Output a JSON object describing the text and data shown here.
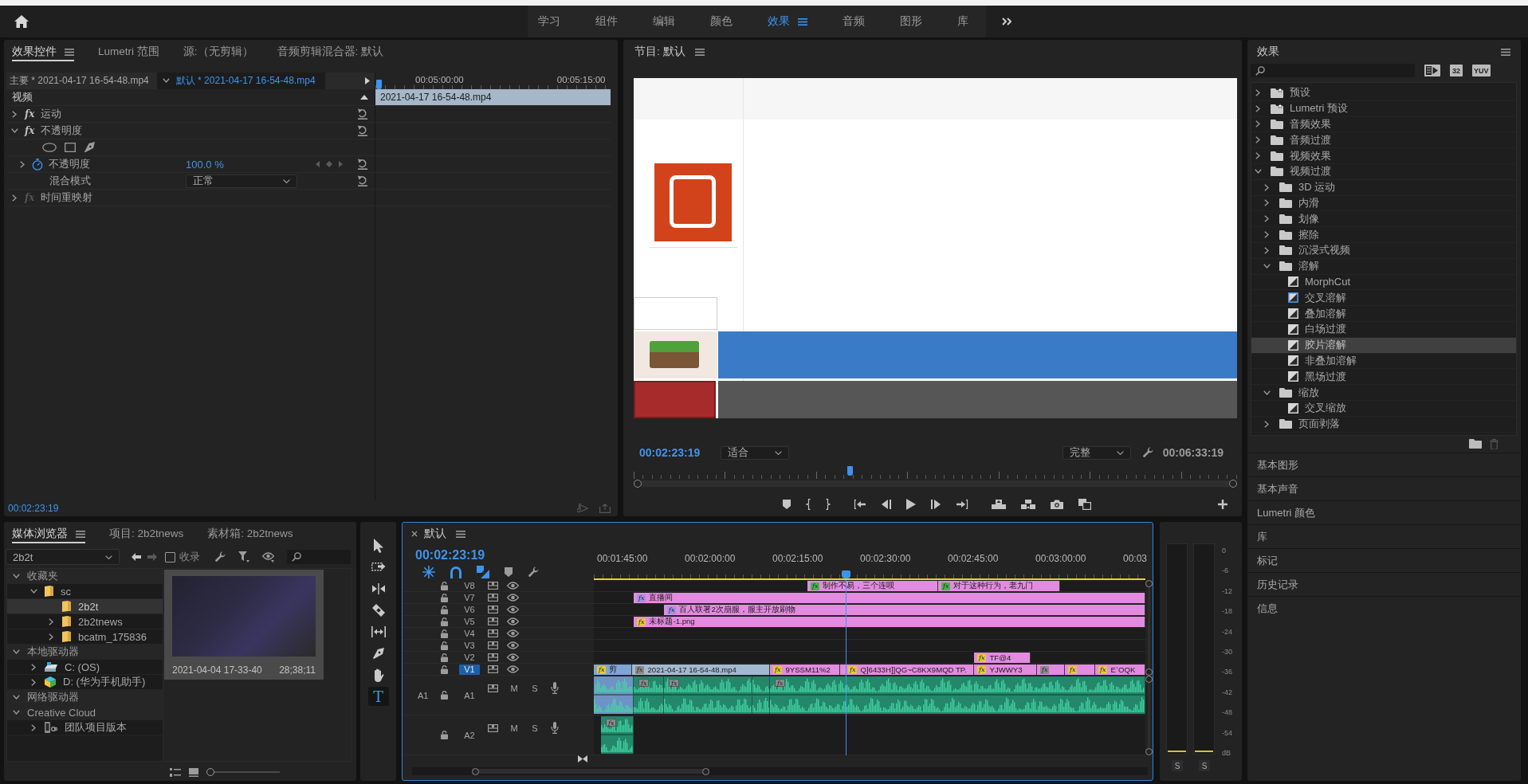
{
  "header": {
    "workspaces": [
      {
        "label": "学习",
        "selected": false
      },
      {
        "label": "组件",
        "selected": false
      },
      {
        "label": "编辑",
        "selected": false
      },
      {
        "label": "颜色",
        "selected": false
      },
      {
        "label": "效果",
        "selected": true
      },
      {
        "label": "音频",
        "selected": false
      },
      {
        "label": "图形",
        "selected": false
      },
      {
        "label": "库",
        "selected": false
      }
    ]
  },
  "effect_controls": {
    "tabs": [
      {
        "label": "效果控件",
        "selected": true
      },
      {
        "label": "Lumetri 范围",
        "selected": false
      },
      {
        "label": "源:（无剪辑）",
        "selected": false
      },
      {
        "label": "音频剪辑混合器: 默认",
        "selected": false
      }
    ],
    "master_clip": "主要 * 2021-04-17 16-54-48.mp4",
    "sequence_clip": "默认 * 2021-04-17 16-54-48.mp4",
    "ruler": [
      "00:05:00:00",
      "00:05:15:00"
    ],
    "section": "视频",
    "clip": "2021-04-17 16-54-48.mp4",
    "rows": [
      {
        "kind": "effect",
        "badge": "fx",
        "label": "运动",
        "expanded": false,
        "enabled": true
      },
      {
        "kind": "effect",
        "badge": "fx",
        "label": "不透明度",
        "expanded": true,
        "enabled": true
      },
      {
        "kind": "masks"
      },
      {
        "kind": "param",
        "label": "不透明度",
        "value": "100.0 %",
        "expanded": false
      },
      {
        "kind": "select",
        "label": "混合模式",
        "value": "正常"
      },
      {
        "kind": "effect",
        "badge": "fx",
        "label": "时间重映射",
        "expanded": false,
        "enabled": false
      }
    ],
    "timecode": "00:02:23:19"
  },
  "program": {
    "title": "节目: 默认",
    "timecode": "00:02:23:19",
    "zoom": "适合",
    "quality": "完整",
    "duration": "00:06:33:19"
  },
  "effects": {
    "title": "效果",
    "filters": [
      {
        "kind": "accelerated"
      },
      {
        "kind": "bit-depth",
        "label": "32"
      },
      {
        "kind": "yuv",
        "label": "YUV"
      }
    ],
    "tree": [
      {
        "kind": "preset-folder",
        "label": "预设",
        "expanded": false,
        "selected": false
      },
      {
        "kind": "preset-folder",
        "label": "Lumetri 预设",
        "expanded": false,
        "selected": false
      },
      {
        "kind": "folder",
        "label": "音频效果",
        "expanded": false,
        "selected": false
      },
      {
        "kind": "folder",
        "label": "音频过渡",
        "expanded": false,
        "selected": false
      },
      {
        "kind": "folder",
        "label": "视频效果",
        "expanded": false,
        "selected": false
      },
      {
        "kind": "folder",
        "label": "视频过渡",
        "expanded": true,
        "selected": false,
        "children": [
          {
            "kind": "folder",
            "label": "3D 运动",
            "expanded": false,
            "selected": false
          },
          {
            "kind": "folder",
            "label": "内滑",
            "expanded": false,
            "selected": false
          },
          {
            "kind": "folder",
            "label": "划像",
            "expanded": false,
            "selected": false
          },
          {
            "kind": "folder",
            "label": "擦除",
            "expanded": false,
            "selected": false
          },
          {
            "kind": "folder",
            "label": "沉浸式视频",
            "expanded": false,
            "selected": false
          },
          {
            "kind": "folder",
            "label": "溶解",
            "expanded": true,
            "selected": false,
            "children": [
              {
                "kind": "transition",
                "label": "MorphCut",
                "default": false,
                "selected": false
              },
              {
                "kind": "transition",
                "label": "交叉溶解",
                "default": true,
                "selected": false
              },
              {
                "kind": "transition",
                "label": "叠加溶解",
                "default": false,
                "selected": false
              },
              {
                "kind": "transition",
                "label": "白场过渡",
                "default": false,
                "selected": false
              },
              {
                "kind": "transition",
                "label": "胶片溶解",
                "default": false,
                "selected": true
              },
              {
                "kind": "transition",
                "label": "非叠加溶解",
                "default": false,
                "selected": false
              },
              {
                "kind": "transition",
                "label": "黑场过渡",
                "default": false,
                "selected": false
              }
            ]
          },
          {
            "kind": "folder",
            "label": "缩放",
            "expanded": true,
            "selected": false,
            "children": [
              {
                "kind": "transition",
                "label": "交叉缩放",
                "default": false,
                "selected": false
              }
            ]
          },
          {
            "kind": "folder",
            "label": "页面剥落",
            "expanded": false,
            "selected": false
          }
        ]
      }
    ],
    "panels": [
      {
        "label": "基本图形"
      },
      {
        "label": "基本声音"
      },
      {
        "label": "Lumetri 颜色"
      },
      {
        "label": "库"
      },
      {
        "label": "标记"
      },
      {
        "label": "历史记录"
      },
      {
        "label": "信息"
      }
    ]
  },
  "media_browser": {
    "tabs": [
      {
        "label": "媒体浏览器",
        "selected": true
      },
      {
        "label": "项目: 2b2tnews",
        "selected": false
      },
      {
        "label": "素材箱: 2b2tnews",
        "selected": false
      }
    ],
    "location": "2b2t",
    "ingest": {
      "label": "收录",
      "checked": false
    },
    "tree": [
      {
        "kind": "group",
        "label": "收藏夹",
        "expanded": true,
        "selected": false,
        "children": [
          {
            "kind": "folder",
            "label": "sc",
            "expanded": true,
            "selected": false,
            "children": [
              {
                "kind": "folder",
                "label": "2b2t",
                "leaf": true,
                "selected": true
              },
              {
                "kind": "folder",
                "label": "2b2tnews",
                "expanded": false,
                "selected": false
              },
              {
                "kind": "folder",
                "label": "bcatm_175836",
                "expanded": false,
                "selected": false
              }
            ]
          }
        ]
      },
      {
        "kind": "group",
        "label": "本地驱动器",
        "expanded": true,
        "selected": false,
        "children": [
          {
            "kind": "drive",
            "label": "C: (OS)",
            "expanded": false,
            "selected": false
          },
          {
            "kind": "device",
            "label": "D: (华为手机助手)",
            "expanded": false,
            "selected": false
          }
        ]
      },
      {
        "kind": "group",
        "label": "网络驱动器",
        "expanded": true,
        "selected": false
      },
      {
        "kind": "group",
        "label": "Creative Cloud",
        "expanded": true,
        "selected": false,
        "children": [
          {
            "kind": "team",
            "label": "团队项目版本",
            "expanded": false,
            "selected": false
          }
        ]
      }
    ],
    "items": [
      {
        "name": "2021-04-04 17-33-40",
        "duration": "28;38;11",
        "selected": true
      }
    ],
    "thumb_size": {
      "level": 0
    }
  },
  "tools": [
    {
      "kind": "select",
      "selected": false
    },
    {
      "kind": "track-select",
      "selected": false
    },
    {
      "kind": "ripple",
      "selected": false
    },
    {
      "kind": "razor",
      "selected": false
    },
    {
      "kind": "slip",
      "selected": false
    },
    {
      "kind": "pen",
      "selected": false
    },
    {
      "kind": "hand",
      "selected": false
    },
    {
      "kind": "type",
      "label": "T",
      "selected": true
    }
  ],
  "timeline": {
    "title": "默认",
    "timecode": "00:02:23:19",
    "toggles": [
      {
        "kind": "nest",
        "on": true
      },
      {
        "kind": "snap",
        "on": true
      },
      {
        "kind": "linked",
        "on": true
      }
    ],
    "ruler": [
      "00:01:45:00",
      "00:02:00:00",
      "00:02:15:00",
      "00:02:30:00",
      "00:02:45:00",
      "00:03:00:00",
      "00:03"
    ],
    "video_tracks": [
      {
        "name": "V8",
        "targeted": false,
        "clips": [
          {
            "name": "制作不易，三个连呗",
            "badge": {
              "label": "fx",
              "color": "#4fb04f"
            },
            "color": "#e38be0"
          },
          {
            "name": "对于这种行为，老九门",
            "badge": {
              "label": "fx",
              "color": "#4fb04f"
            },
            "color": "#e38be0"
          }
        ]
      },
      {
        "name": "V7",
        "targeted": false,
        "clips": [
          {
            "name": "直播间",
            "badge": {
              "label": "fx",
              "color": "#a592e6"
            },
            "color": "#e38be0"
          }
        ]
      },
      {
        "name": "V6",
        "targeted": false,
        "clips": [
          {
            "name": "百人联署2次崩服，服主开放刷物",
            "badge": {
              "label": "fx",
              "color": "#a592e6"
            },
            "color": "#e38be0"
          }
        ]
      },
      {
        "name": "V5",
        "targeted": false,
        "clips": [
          {
            "name": "未标题-1.png",
            "badge": {
              "label": "fx",
              "color": "#e2c93b"
            },
            "color": "#e38be0"
          }
        ]
      },
      {
        "name": "V4",
        "targeted": false
      },
      {
        "name": "V3",
        "targeted": false
      },
      {
        "name": "V2",
        "targeted": false,
        "clips": [
          {
            "name": "TF@4",
            "badge": {
              "label": "fx",
              "color": "#e2c93b"
            },
            "color": "#e38be0"
          }
        ]
      },
      {
        "name": "V1",
        "targeted": true,
        "clips": [
          {
            "name": "剪",
            "badge": {
              "label": "fx",
              "color": "#e2c93b"
            },
            "color": "#7fa4d6"
          },
          {
            "name": "2021-04-17 16-54-48.mp4",
            "badge": {
              "label": "fx",
              "color": "#8a8a8a"
            },
            "color": "#a2b9d1"
          },
          {
            "name": "9YSSM11%2",
            "badge": {
              "label": "fx",
              "color": "#e2c93b"
            },
            "color": "#e38be0"
          },
          {
            "name": "Q]6433H]]QG~C8KX9MQD TP.",
            "badge": {
              "label": "fx",
              "color": "#e2c93b"
            },
            "color": "#e38be0"
          },
          {
            "name": "YJWWY3",
            "badge": {
              "label": "fx",
              "color": "#e2c93b"
            },
            "color": "#e38be0"
          },
          {
            "badge": {
              "label": "fx",
              "color": "#8a8a8a"
            },
            "color": "#e38be0"
          },
          {
            "badge": {
              "label": "fx",
              "color": "#e2c93b"
            },
            "color": "#e38be0"
          },
          {
            "name": "E`OQK",
            "badge": {
              "label": "fx",
              "color": "#e2c93b"
            },
            "color": "#e38be0"
          }
        ]
      }
    ],
    "audio_tracks": [
      {
        "source": "A1",
        "name": "A1",
        "mute": "M",
        "solo": "S",
        "clips": [
          {
            "color": "#6f93c6"
          },
          {
            "color": "#24876a",
            "badge": {
              "label": "fx",
              "color": "#8a8a8a"
            }
          },
          {
            "color": "#24876a",
            "badge": {
              "label": "fx",
              "color": "#8a8a8a"
            }
          },
          {
            "color": "#24876a"
          },
          {
            "color": "#24876a",
            "badge": {
              "label": "fx",
              "color": "#8a8a8a"
            }
          }
        ]
      },
      {
        "name": "A2",
        "mute": "M",
        "solo": "S",
        "clips": [
          {
            "color": "#24876a",
            "badge": {
              "label": "fx",
              "color": "#8a8a8a"
            }
          }
        ]
      }
    ]
  },
  "meters": {
    "scale": [
      "0",
      "-6",
      "-12",
      "-18",
      "-24",
      "-30",
      "-36",
      "-42",
      "-48",
      "-54",
      "dB"
    ],
    "channels": [
      {
        "solo": "S"
      },
      {
        "solo": "S"
      }
    ]
  }
}
